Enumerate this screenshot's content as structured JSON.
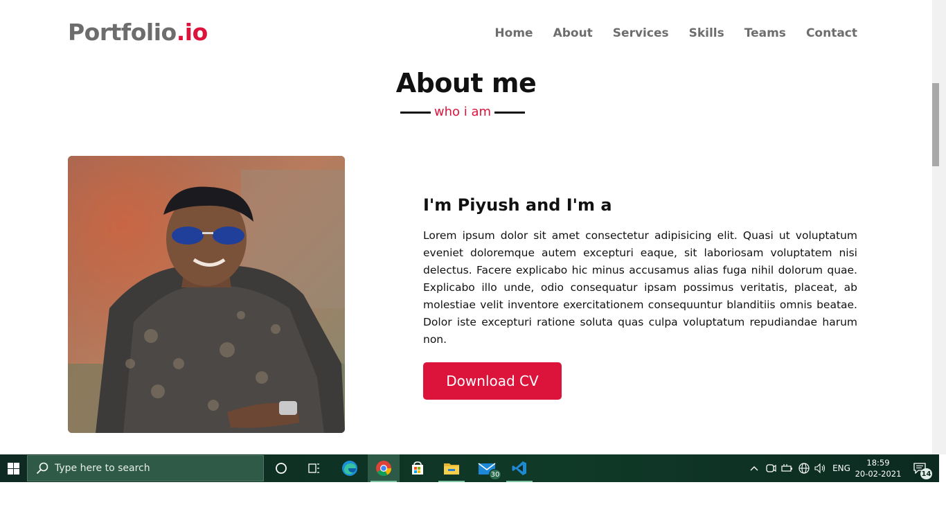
{
  "nav": {
    "logo_main": "Portfolio",
    "logo_accent": ".io",
    "items": [
      "Home",
      "About",
      "Services",
      "Skills",
      "Teams",
      "Contact"
    ]
  },
  "section": {
    "title": "About me",
    "subtitle": "who i am"
  },
  "about": {
    "intro": "I'm Piyush and I'm a",
    "paragraph": "Lorem ipsum dolor sit amet consectetur adipisicing elit. Quasi ut voluptatum eveniet doloremque autem excepturi eaque, sit laboriosam voluptatem nisi delectus. Facere explicabo hic minus accusamus alias fuga nihil dolorum quae. Explicabo illo unde, odio consequatur ipsam possimus veritatis, placeat, ab molestiae velit inventore exercitationem consequuntur blanditiis omnis beatae. Dolor iste excepturi ratione soluta quas culpa voluptatum repudiandae harum non.",
    "cv_button": "Download CV"
  },
  "colors": {
    "accent": "#dc143c",
    "nav_text": "#6d6d6d"
  },
  "taskbar": {
    "search_placeholder": "Type here to search",
    "apps": [
      "cortana-icon",
      "task-view-icon",
      "edge-icon",
      "chrome-icon",
      "store-icon",
      "file-explorer-icon",
      "mail-icon",
      "vscode-icon"
    ],
    "mail_badge": "30",
    "language": "ENG",
    "time": "18:59",
    "date": "20-02-2021",
    "notification_count": "14"
  }
}
